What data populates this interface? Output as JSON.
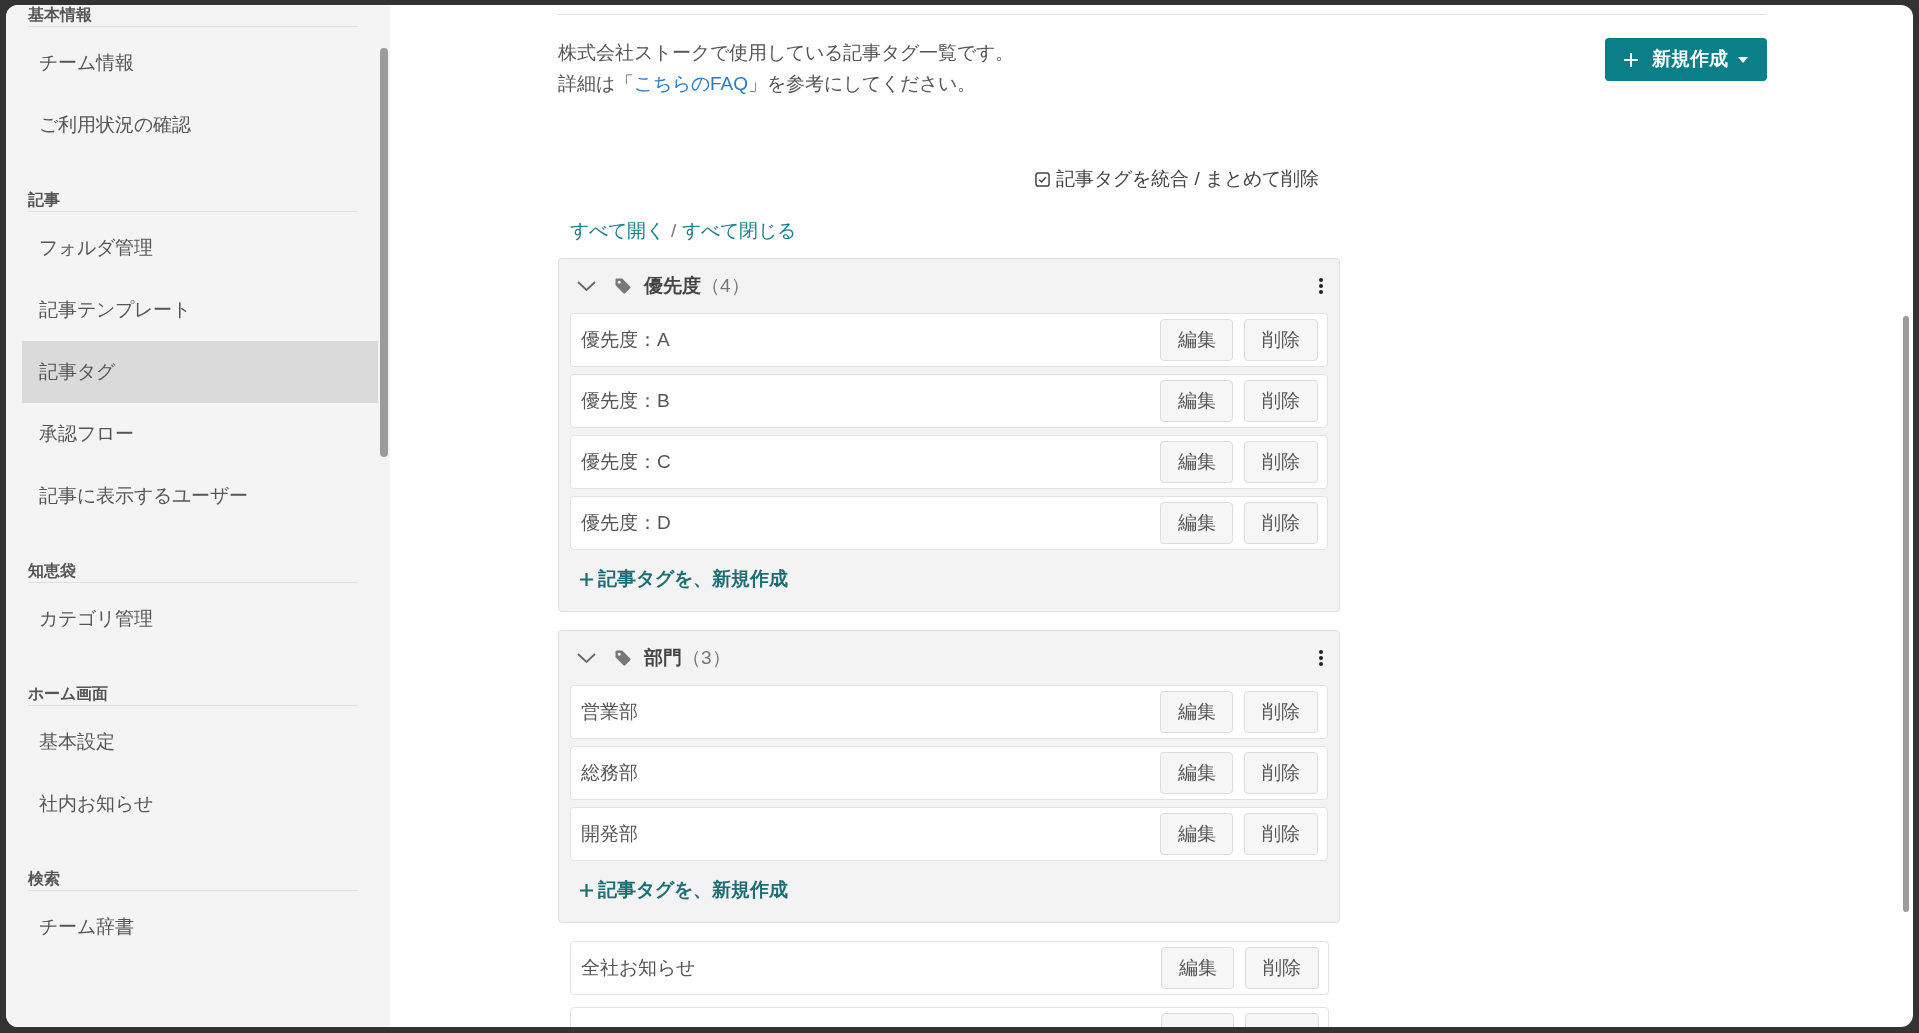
{
  "sidebar": {
    "sections": [
      {
        "heading": "基本情報",
        "items": [
          {
            "label": "チーム情報",
            "selected": false
          },
          {
            "label": "ご利用状況の確認",
            "selected": false
          }
        ]
      },
      {
        "heading": "記事",
        "items": [
          {
            "label": "フォルダ管理",
            "selected": false
          },
          {
            "label": "記事テンプレート",
            "selected": false
          },
          {
            "label": "記事タグ",
            "selected": true
          },
          {
            "label": "承認フロー",
            "selected": false
          },
          {
            "label": "記事に表示するユーザー",
            "selected": false
          }
        ]
      },
      {
        "heading": "知恵袋",
        "items": [
          {
            "label": "カテゴリ管理",
            "selected": false
          }
        ]
      },
      {
        "heading": "ホーム画面",
        "items": [
          {
            "label": "基本設定",
            "selected": false
          },
          {
            "label": "社内お知らせ",
            "selected": false
          }
        ]
      },
      {
        "heading": "検索",
        "items": [
          {
            "label": "チーム辞書",
            "selected": false
          }
        ]
      }
    ]
  },
  "description": {
    "line_1": "株式会社ストークで使用している記事タグ一覧です。",
    "line_2_before": "詳細は「",
    "link": "こちらのFAQ",
    "line_2_after": "」を参考にしてください。"
  },
  "new_button": {
    "label": "新規作成"
  },
  "merge_button": {
    "label": "記事タグを統合 / まとめて削除"
  },
  "expand_links": {
    "expand_all": "すべて開く",
    "separator": "/",
    "collapse_all": "すべて閉じる"
  },
  "tag_groups": [
    {
      "name": "優先度",
      "count": "（4）",
      "expanded": true,
      "tags": [
        {
          "name": "優先度：A",
          "edit_label": "編集",
          "delete_label": "削除"
        },
        {
          "name": "優先度：B",
          "edit_label": "編集",
          "delete_label": "削除"
        },
        {
          "name": "優先度：C",
          "edit_label": "編集",
          "delete_label": "削除"
        },
        {
          "name": "優先度：D",
          "edit_label": "編集",
          "delete_label": "削除"
        }
      ],
      "add_label": "記事タグを、新規作成"
    },
    {
      "name": "部門",
      "count": "（3）",
      "expanded": true,
      "tags": [
        {
          "name": "営業部",
          "edit_label": "編集",
          "delete_label": "削除"
        },
        {
          "name": "総務部",
          "edit_label": "編集",
          "delete_label": "削除"
        },
        {
          "name": "開発部",
          "edit_label": "編集",
          "delete_label": "削除"
        }
      ],
      "add_label": "記事タグを、新規作成"
    }
  ],
  "ungrouped_tags": [
    {
      "kind": "tag",
      "name": "全社お知らせ",
      "edit_label": "編集",
      "delete_label": "削除"
    },
    {
      "kind": "cut_off"
    }
  ]
}
